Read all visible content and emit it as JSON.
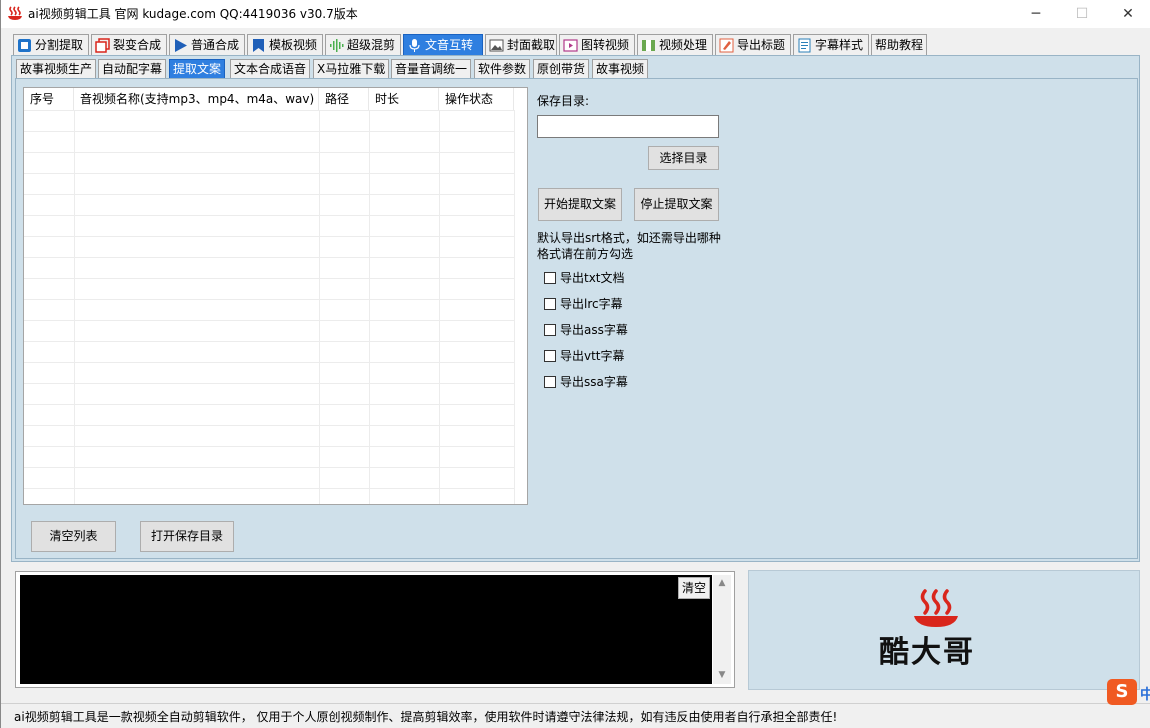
{
  "window": {
    "title": "ai视频剪辑工具 官网 kudage.com QQ:4419036    v30.7版本",
    "minimize": "─",
    "maximize": "☐",
    "close": "✕"
  },
  "main_tabs": [
    {
      "label": "分割提取",
      "icon": "blue-square-icon"
    },
    {
      "label": "裂变合成",
      "icon": "red-layers-icon"
    },
    {
      "label": "普通合成",
      "icon": "play-icon"
    },
    {
      "label": "模板视频",
      "icon": "bookmark-icon"
    },
    {
      "label": "超级混剪",
      "icon": "waveform-icon"
    },
    {
      "label": "文音互转",
      "icon": "microphone-icon",
      "active": true
    },
    {
      "label": "封面截取",
      "icon": "image-icon"
    },
    {
      "label": "图转视频",
      "icon": "video-frame-icon"
    },
    {
      "label": "视频处理",
      "icon": "film-icon"
    },
    {
      "label": "导出标题",
      "icon": "edit-icon"
    },
    {
      "label": "字幕样式",
      "icon": "document-icon"
    },
    {
      "label": "帮助教程",
      "icon": ""
    }
  ],
  "sub_tabs": [
    {
      "label": "故事视频生产"
    },
    {
      "label": "自动配字幕"
    },
    {
      "label": "提取文案",
      "active": true
    },
    {
      "label": "文本合成语音"
    },
    {
      "label": "X马拉雅下载"
    },
    {
      "label": "音量音调统一"
    },
    {
      "label": "软件参数"
    },
    {
      "label": "原创带货"
    },
    {
      "label": "故事视频"
    }
  ],
  "table": {
    "columns": [
      "序号",
      "音视频名称(支持mp3、mp4、m4a、wav)",
      "路径",
      "时长",
      "操作状态"
    ],
    "rows": []
  },
  "right_panel": {
    "save_dir_label": "保存目录:",
    "save_dir_value": "",
    "choose_dir_button": "选择目录",
    "start_button": "开始提取文案",
    "stop_button": "停止提取文案",
    "hint_line1": "默认导出srt格式，如还需导出哪种",
    "hint_line2": "格式请在前方勾选",
    "options": [
      {
        "label": "导出txt文档",
        "checked": false
      },
      {
        "label": "导出lrc字幕",
        "checked": false
      },
      {
        "label": "导出ass字幕",
        "checked": false
      },
      {
        "label": "导出vtt字幕",
        "checked": false
      },
      {
        "label": "导出ssa字幕",
        "checked": false
      }
    ]
  },
  "bottom_buttons": {
    "clear_list": "清空列表",
    "open_save_dir": "打开保存目录"
  },
  "log": {
    "clear_button": "清空",
    "content": ""
  },
  "logo": {
    "text": "酷大哥",
    "color": "#d9261c"
  },
  "status": {
    "text": "ai视频剪辑工具是一款视频全自动剪辑软件， 仅用于个人原创视频制作、提高剪辑效率，使用软件时请遵守法律法规，如有违反由使用者自行承担全部责任!"
  },
  "ime": {
    "label": "S",
    "side": "中"
  }
}
